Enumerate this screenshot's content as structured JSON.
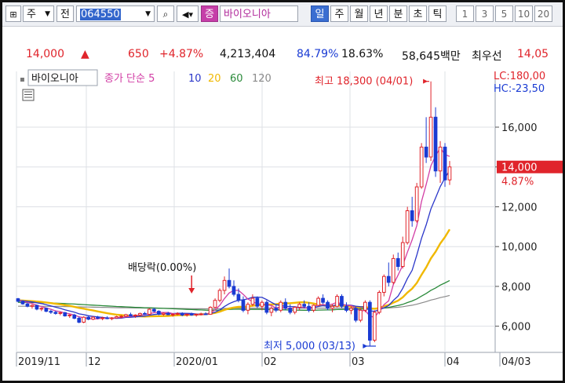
{
  "toolbar": {
    "jong_label": "주",
    "jeon_label": "전",
    "code": "064550",
    "badge": "증",
    "name": "바이오니아",
    "periods": [
      "일",
      "주",
      "월",
      "년",
      "분",
      "초",
      "틱"
    ],
    "active_period": "일",
    "ticks": [
      "1",
      "3",
      "5",
      "10",
      "20"
    ]
  },
  "quote": {
    "price": "14,000",
    "arrow": "▲",
    "change": "650",
    "pct": "+4.87%",
    "volume": "4,213,404",
    "vol_ratio": "84.79%",
    "turnover": "18.63%",
    "amount": "58,645백만",
    "badge": "최우선",
    "last": "14,05"
  },
  "legend": {
    "name": "바이오니아",
    "text": "종가 단순",
    "ma5": "5",
    "ma10": "10",
    "ma20": "20",
    "ma60": "60",
    "ma120": "120"
  },
  "colors": {
    "up": "#e0242b",
    "down": "#1a3bd3",
    "ma5": "#d23ea5",
    "ma10": "#2a36c9",
    "ma20": "#f0b800",
    "ma60": "#2a8a3a",
    "ma120": "#8a8a8a"
  },
  "chart_data": {
    "type": "candlestick",
    "title": "바이오니아",
    "ylim": [
      5000,
      18800
    ],
    "yticks": [
      6000,
      8000,
      10000,
      12000,
      14000,
      16000
    ],
    "ytick_labels": [
      "6,000",
      "8,000",
      "10,000",
      "12,000",
      "14,000",
      "16,000"
    ],
    "xtick_labels": [
      "2019/11",
      "12",
      "2020/01",
      "02",
      "03",
      "04",
      "04/03"
    ],
    "annotations": {
      "high": "최고 18,300 (04/01)",
      "low": "최저 5,000 (03/13)",
      "dividend": "배당락(0.00%)"
    },
    "right_labels": {
      "lc": "LC:180,00",
      "hc": "HC:-23,50",
      "current": "14,000",
      "pct": "4.87%"
    },
    "moving_averages": [
      "5",
      "10",
      "20",
      "60",
      "120"
    ],
    "ohlc": [
      [
        7380,
        7420,
        7200,
        7250
      ],
      [
        7250,
        7300,
        7080,
        7120
      ],
      [
        7120,
        7180,
        6950,
        7000
      ],
      [
        7000,
        7100,
        6880,
        7050
      ],
      [
        7050,
        7080,
        6800,
        6860
      ],
      [
        6860,
        6950,
        6760,
        6900
      ],
      [
        6900,
        6940,
        6700,
        6750
      ],
      [
        6750,
        6820,
        6620,
        6700
      ],
      [
        6700,
        6780,
        6580,
        6640
      ],
      [
        6640,
        6720,
        6550,
        6680
      ],
      [
        6680,
        6720,
        6480,
        6520
      ],
      [
        6520,
        6600,
        6420,
        6560
      ],
      [
        6560,
        6620,
        6350,
        6400
      ],
      [
        6400,
        6480,
        6150,
        6200
      ],
      [
        6200,
        6500,
        6150,
        6450
      ],
      [
        6450,
        6520,
        6300,
        6350
      ],
      [
        6350,
        6500,
        6300,
        6450
      ],
      [
        6450,
        6520,
        6350,
        6400
      ],
      [
        6400,
        6480,
        6300,
        6420
      ],
      [
        6420,
        6500,
        6350,
        6380
      ],
      [
        6380,
        6460,
        6300,
        6420
      ],
      [
        6420,
        6520,
        6380,
        6480
      ],
      [
        6480,
        6560,
        6400,
        6500
      ],
      [
        6500,
        6620,
        6450,
        6580
      ],
      [
        6580,
        6680,
        6500,
        6520
      ],
      [
        6520,
        6600,
        6420,
        6560
      ],
      [
        6560,
        6680,
        6500,
        6640
      ],
      [
        6640,
        6720,
        6560,
        6600
      ],
      [
        6600,
        6900,
        6550,
        6850
      ],
      [
        6850,
        6920,
        6700,
        6750
      ],
      [
        6750,
        6800,
        6550,
        6600
      ],
      [
        6600,
        6700,
        6520,
        6650
      ],
      [
        6650,
        6720,
        6550,
        6580
      ],
      [
        6580,
        6650,
        6480,
        6600
      ],
      [
        6600,
        6700,
        6550,
        6640
      ],
      [
        6640,
        6700,
        6500,
        6560
      ],
      [
        6560,
        6640,
        6480,
        6600
      ],
      [
        6600,
        6680,
        6520,
        6560
      ],
      [
        6560,
        6640,
        6480,
        6600
      ],
      [
        6600,
        6680,
        6540,
        6620
      ],
      [
        6620,
        6700,
        6560,
        6600
      ],
      [
        6600,
        7000,
        6580,
        6950
      ],
      [
        6950,
        7400,
        6900,
        7300
      ],
      [
        7300,
        7900,
        7200,
        7800
      ],
      [
        7800,
        8500,
        7600,
        8300
      ],
      [
        8300,
        8900,
        7900,
        8000
      ],
      [
        8000,
        8300,
        7500,
        7600
      ],
      [
        7600,
        7900,
        7200,
        7300
      ],
      [
        7300,
        7500,
        6700,
        6800
      ],
      [
        6800,
        7200,
        6600,
        7100
      ],
      [
        7100,
        7600,
        7000,
        7400
      ],
      [
        7400,
        7500,
        6900,
        7000
      ],
      [
        7000,
        7300,
        6800,
        7200
      ],
      [
        7200,
        7300,
        6600,
        6700
      ],
      [
        6700,
        7000,
        6500,
        6900
      ],
      [
        6900,
        7100,
        6700,
        6800
      ],
      [
        6800,
        7300,
        6700,
        7200
      ],
      [
        7200,
        7400,
        6800,
        6900
      ],
      [
        6900,
        7100,
        6600,
        6700
      ],
      [
        6700,
        7000,
        6600,
        6950
      ],
      [
        6950,
        7200,
        6800,
        7100
      ],
      [
        7100,
        7300,
        6900,
        7000
      ],
      [
        7000,
        7200,
        6700,
        6800
      ],
      [
        6800,
        7100,
        6700,
        7050
      ],
      [
        7050,
        7500,
        7000,
        7400
      ],
      [
        7400,
        7600,
        7100,
        7200
      ],
      [
        7200,
        7300,
        6800,
        6900
      ],
      [
        6900,
        7100,
        6700,
        7000
      ],
      [
        7000,
        7600,
        6950,
        7500
      ],
      [
        7500,
        7600,
        6900,
        7000
      ],
      [
        7000,
        7200,
        6700,
        6800
      ],
      [
        6800,
        7000,
        6600,
        6900
      ],
      [
        6900,
        7000,
        6200,
        6300
      ],
      [
        6300,
        6900,
        6200,
        6800
      ],
      [
        6800,
        7300,
        6700,
        7200
      ],
      [
        7200,
        7300,
        5000,
        5300
      ],
      [
        5300,
        6800,
        5200,
        6700
      ],
      [
        6700,
        7800,
        6600,
        7700
      ],
      [
        7700,
        8600,
        7500,
        8500
      ],
      [
        8500,
        9200,
        8000,
        8200
      ],
      [
        8200,
        9600,
        8100,
        9400
      ],
      [
        9400,
        9700,
        8800,
        9000
      ],
      [
        9000,
        10500,
        8900,
        10200
      ],
      [
        10200,
        12000,
        10100,
        11800
      ],
      [
        11800,
        12500,
        11000,
        11300
      ],
      [
        11300,
        13200,
        11200,
        13000
      ],
      [
        13000,
        15200,
        12900,
        15000
      ],
      [
        15000,
        16500,
        14200,
        14500
      ],
      [
        14500,
        18300,
        14300,
        16500
      ],
      [
        16500,
        17000,
        13500,
        13800
      ],
      [
        13800,
        15300,
        13200,
        15000
      ],
      [
        15000,
        15200,
        13000,
        13350
      ],
      [
        13350,
        14300,
        13100,
        14000
      ]
    ],
    "dividend_index": 37,
    "high_index": 88,
    "low_index": 75
  }
}
